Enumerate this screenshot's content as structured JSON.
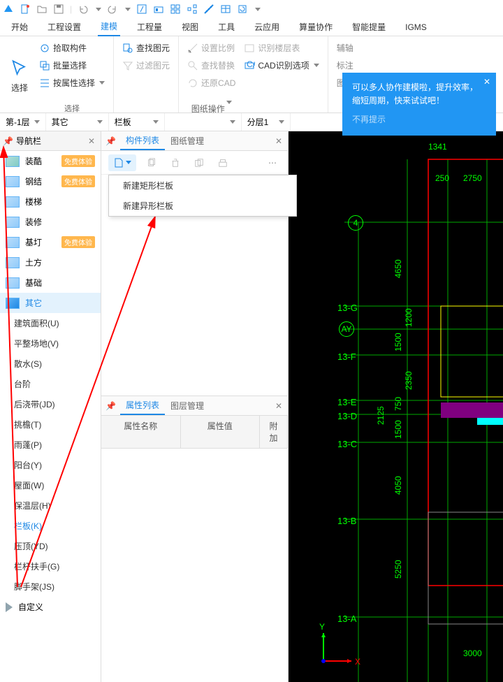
{
  "ribbon": {
    "tabs": [
      "开始",
      "工程设置",
      "建模",
      "工程量",
      "视图",
      "工具",
      "云应用",
      "算量协作",
      "智能提量",
      "IGMS"
    ],
    "active": "建模",
    "select_group": {
      "big": "选择",
      "items": [
        "拾取构件",
        "批量选择",
        "按属性选择"
      ],
      "label": "选择"
    },
    "find_group": {
      "items": [
        "查找图元",
        "过滤图元"
      ]
    },
    "cad_group": {
      "items": [
        "设置比例",
        "查找替换",
        "还原CAD",
        "识别楼层表",
        "CAD识别选项"
      ],
      "label": "图纸操作"
    },
    "hidden_group": {
      "items": [
        "辅轴",
        "标注",
        "图元"
      ]
    }
  },
  "tooltip": {
    "line1": "可以多人协作建模啦，提升效率，",
    "line2": "缩短周期，快来试试吧！",
    "link": "不再提示"
  },
  "filters": {
    "floor": "第-1层",
    "cat": "其它",
    "type": "栏板",
    "sub": "",
    "layer": "分层1"
  },
  "nav": {
    "title": "导航栏",
    "cats": [
      {
        "label": "装酷",
        "badge": "免费体验"
      },
      {
        "label": "钢结",
        "badge": "免费体验"
      },
      {
        "label": "楼梯"
      },
      {
        "label": "装修"
      },
      {
        "label": "基圢",
        "badge": "免费体验"
      },
      {
        "label": "土方"
      },
      {
        "label": "基础"
      },
      {
        "label": "其它",
        "sel": true
      }
    ],
    "subs": [
      "建筑面积(U)",
      "平整场地(V)",
      "散水(S)",
      "台阶",
      "后浇带(JD)",
      "挑檐(T)",
      "雨蓬(P)",
      "阳台(Y)",
      "屋面(W)",
      "保温层(H)",
      "栏板(K)",
      "压顶(YD)",
      "栏杆扶手(G)",
      "脚手架(JS)",
      "自定义"
    ],
    "sub_hl": "栏板(K)"
  },
  "mid": {
    "tabs": [
      "构件列表",
      "图纸管理"
    ],
    "active": "构件列表",
    "menu": [
      "新建矩形栏板",
      "新建异形栏板"
    ],
    "search_ph": "",
    "prop_tabs": [
      "属性列表",
      "图层管理"
    ],
    "prop_active": "属性列表",
    "prop_cols": [
      "属性名称",
      "属性值",
      "附加"
    ]
  },
  "cad": {
    "top_dims": [
      "1341",
      "250",
      "2750"
    ],
    "grid_labels": [
      "4",
      "13-G",
      "AY",
      "13-F",
      "13-E",
      "13-D",
      "13-C",
      "13-B",
      "13-A"
    ],
    "v_dims": [
      "4650",
      "1200",
      "1500",
      "2350",
      "750",
      "2125",
      "1500",
      "4050",
      "5250"
    ],
    "bottom_dim": "3000",
    "axes": {
      "x": "X",
      "y": "Y"
    }
  }
}
